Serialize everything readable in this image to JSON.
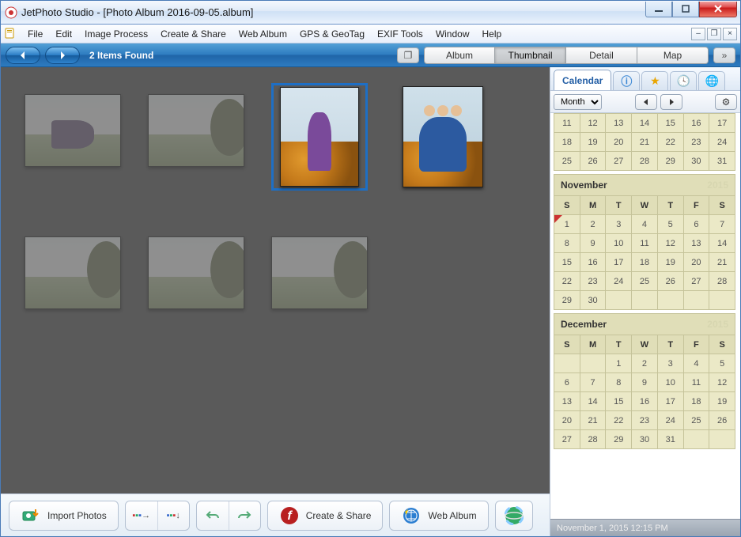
{
  "window": {
    "title": "JetPhoto Studio - [Photo Album 2016-09-05.album]"
  },
  "menu": [
    "File",
    "Edit",
    "Image Process",
    "Create & Share",
    "Web Album",
    "GPS & GeoTag",
    "EXIF Tools",
    "Window",
    "Help"
  ],
  "toolbar": {
    "status": "2 Items Found",
    "views": [
      "Album",
      "Thumbnail",
      "Detail",
      "Map"
    ],
    "active_view": 1
  },
  "thumbnails": [
    {
      "dim": true,
      "orient": "landscape",
      "kind": "portrait-person"
    },
    {
      "dim": true,
      "orient": "landscape",
      "kind": "field"
    },
    {
      "dim": false,
      "orient": "portrait",
      "kind": "leaves-girl",
      "selected": true
    },
    {
      "dim": false,
      "orient": "portrait",
      "kind": "leaves-family"
    },
    {
      "dim": true,
      "orient": "landscape",
      "kind": "field"
    },
    {
      "dim": true,
      "orient": "landscape",
      "kind": "field"
    },
    {
      "dim": true,
      "orient": "landscape",
      "kind": "field"
    }
  ],
  "actions": {
    "import": "Import Photos",
    "create_share": "Create & Share",
    "web_album": "Web Album"
  },
  "side": {
    "tab_label": "Calendar",
    "range_select": "Month",
    "status": "November 1, 2015 12:15 PM",
    "months": [
      {
        "name": "",
        "year": "",
        "hide_header": true,
        "first_dow": -1,
        "start": 11,
        "end": 31,
        "today": null
      },
      {
        "name": "November",
        "year": "2015",
        "first_dow": 0,
        "start": 1,
        "end": 30,
        "today": 1
      },
      {
        "name": "December",
        "year": "2015",
        "first_dow": 2,
        "start": 1,
        "end": 31,
        "today": null
      }
    ],
    "dow": [
      "S",
      "M",
      "T",
      "W",
      "T",
      "F",
      "S"
    ]
  }
}
